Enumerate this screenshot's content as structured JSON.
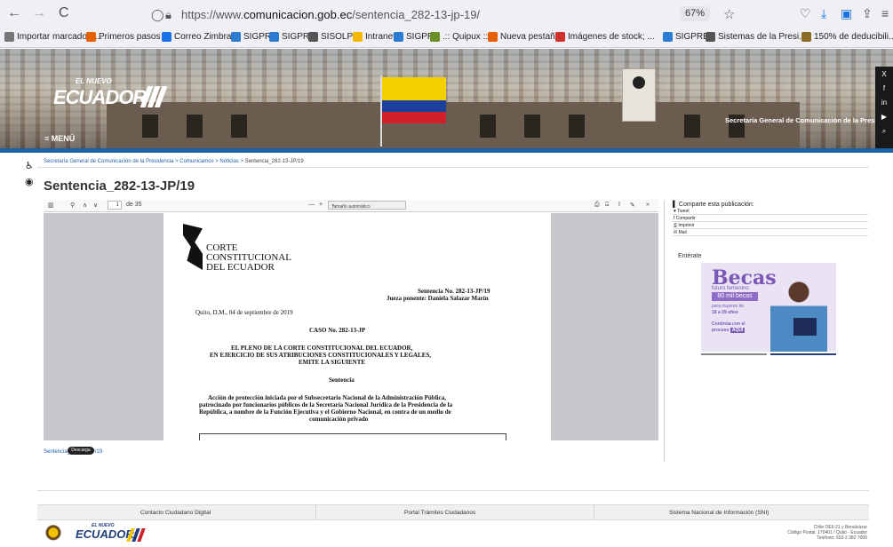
{
  "browser": {
    "back": "←",
    "forward": "→",
    "reload": "C",
    "url_prefix": "https://www.",
    "url_domain": "comunicacion.gob.ec",
    "url_path": "/sentencia_282-13-jp-19/",
    "zoom": "67%"
  },
  "bookmarks": [
    {
      "label": "Importar marcadore...",
      "color": "#777777"
    },
    {
      "label": "Primeros pasos",
      "color": "#e66000"
    },
    {
      "label": "Correo Zimbra",
      "color": "#1a73e8"
    },
    {
      "label": "SIGPRE",
      "color": "#2b7bd3"
    },
    {
      "label": "SIGPRE",
      "color": "#2b7bd3"
    },
    {
      "label": "SISOLP",
      "color": "#555555"
    },
    {
      "label": "Intranet",
      "color": "#f5b800"
    },
    {
      "label": "SIGPRE",
      "color": "#2b7bd3"
    },
    {
      "label": ".:: Quipux ::.",
      "color": "#6b8e23"
    },
    {
      "label": "Nueva pestaña",
      "color": "#e66000"
    },
    {
      "label": "Imágenes de stock; ...",
      "color": "#d0312d"
    },
    {
      "label": "SIGPRE",
      "color": "#2b7bd3"
    },
    {
      "label": "Sistemas de la Presi...",
      "color": "#555555"
    },
    {
      "label": "150% de deducibili...",
      "color": "#8b6b23"
    }
  ],
  "header": {
    "logo_small": "EL NUEVO",
    "logo_big": "ECUADOR",
    "menu": "≡ MENÚ",
    "caption": "Secretaría General de Comunicación de la Presidencia",
    "social": [
      "X",
      "f",
      "in",
      "▶",
      "⌕"
    ]
  },
  "breadcrumb": {
    "items": "Secretaría General de Comunicación de la Presidencia > Comunicamos > Noticias > ",
    "current": "Sentencia_282-13-JP/19"
  },
  "page_title": "Sentencia_282-13-JP/19",
  "pdf_toolbar": {
    "page_value": "1",
    "page_total": "de 35",
    "zoom_option": "Tamaño automático"
  },
  "pdf_page": {
    "court_line1": "CORTE",
    "court_line2": "CONSTITUCIONAL",
    "court_line3": "DEL ECUADOR",
    "sentencia_no": "Sentencia No. 282-13-JP/19",
    "jueza": "Jueza ponente: Daniela Salazar Marín",
    "place_date": "Quito, D.M., 04 de septiembre de 2019",
    "caso": "CASO No. 282-13-JP",
    "pleno1": "EL PLENO DE LA CORTE CONSTITUCIONAL DEL ECUADOR,",
    "pleno2": "EN EJERCICIO DE SUS ATRIBUCIONES CONSTITUCIONALES Y LEGALES,",
    "pleno3": "EMITE LA SIGUIENTE",
    "sentencia": "Sentencia",
    "body1": "Acción de protección iniciada por el Subsecretario Nacional de la Administración Pública,",
    "body2": "patrocinado por funcionarios públicos de la Secretaría Nacional Jurídica de la Presidencia de la",
    "body3": "República, a nombre de la Función Ejecutiva y el Gobierno Nacional, en contra de un medio de",
    "body4": "comunicación privado"
  },
  "document_link": "Sentencia_282-13-JP/19",
  "download_label": "Descarga",
  "share": {
    "title": "Comparte esta publicación:",
    "items": [
      "♥ Tweet",
      "f Compartir",
      "⎙ Imprimir",
      "✉ Mail"
    ]
  },
  "enterate": "Entérate",
  "ad": {
    "title": "Becas",
    "subtitle": "futuro femenino",
    "pill": "80 mil becas",
    "line1": "para mujeres de",
    "line2": "18 a 29 años",
    "line3": "Continúa con el",
    "line4": "proceso",
    "aqui": "AQUÍ"
  },
  "footer": {
    "links": [
      "Contacto Ciudadano Digital",
      "Portal Trámites Ciudadanos",
      "Sistema Nacional de Información (SNI)"
    ],
    "logo_small": "EL NUEVO",
    "logo_big": "ECUADOR",
    "address1": "Chile OE6-21 y Benalcázar",
    "address2": "Código Postal: 170401 / Quito - Ecuador",
    "address3": "Teléfono: 593-2 382 7000"
  },
  "colors": {
    "brand_blue": "#1f5fa6",
    "ad_purple": "#7b58b6"
  }
}
